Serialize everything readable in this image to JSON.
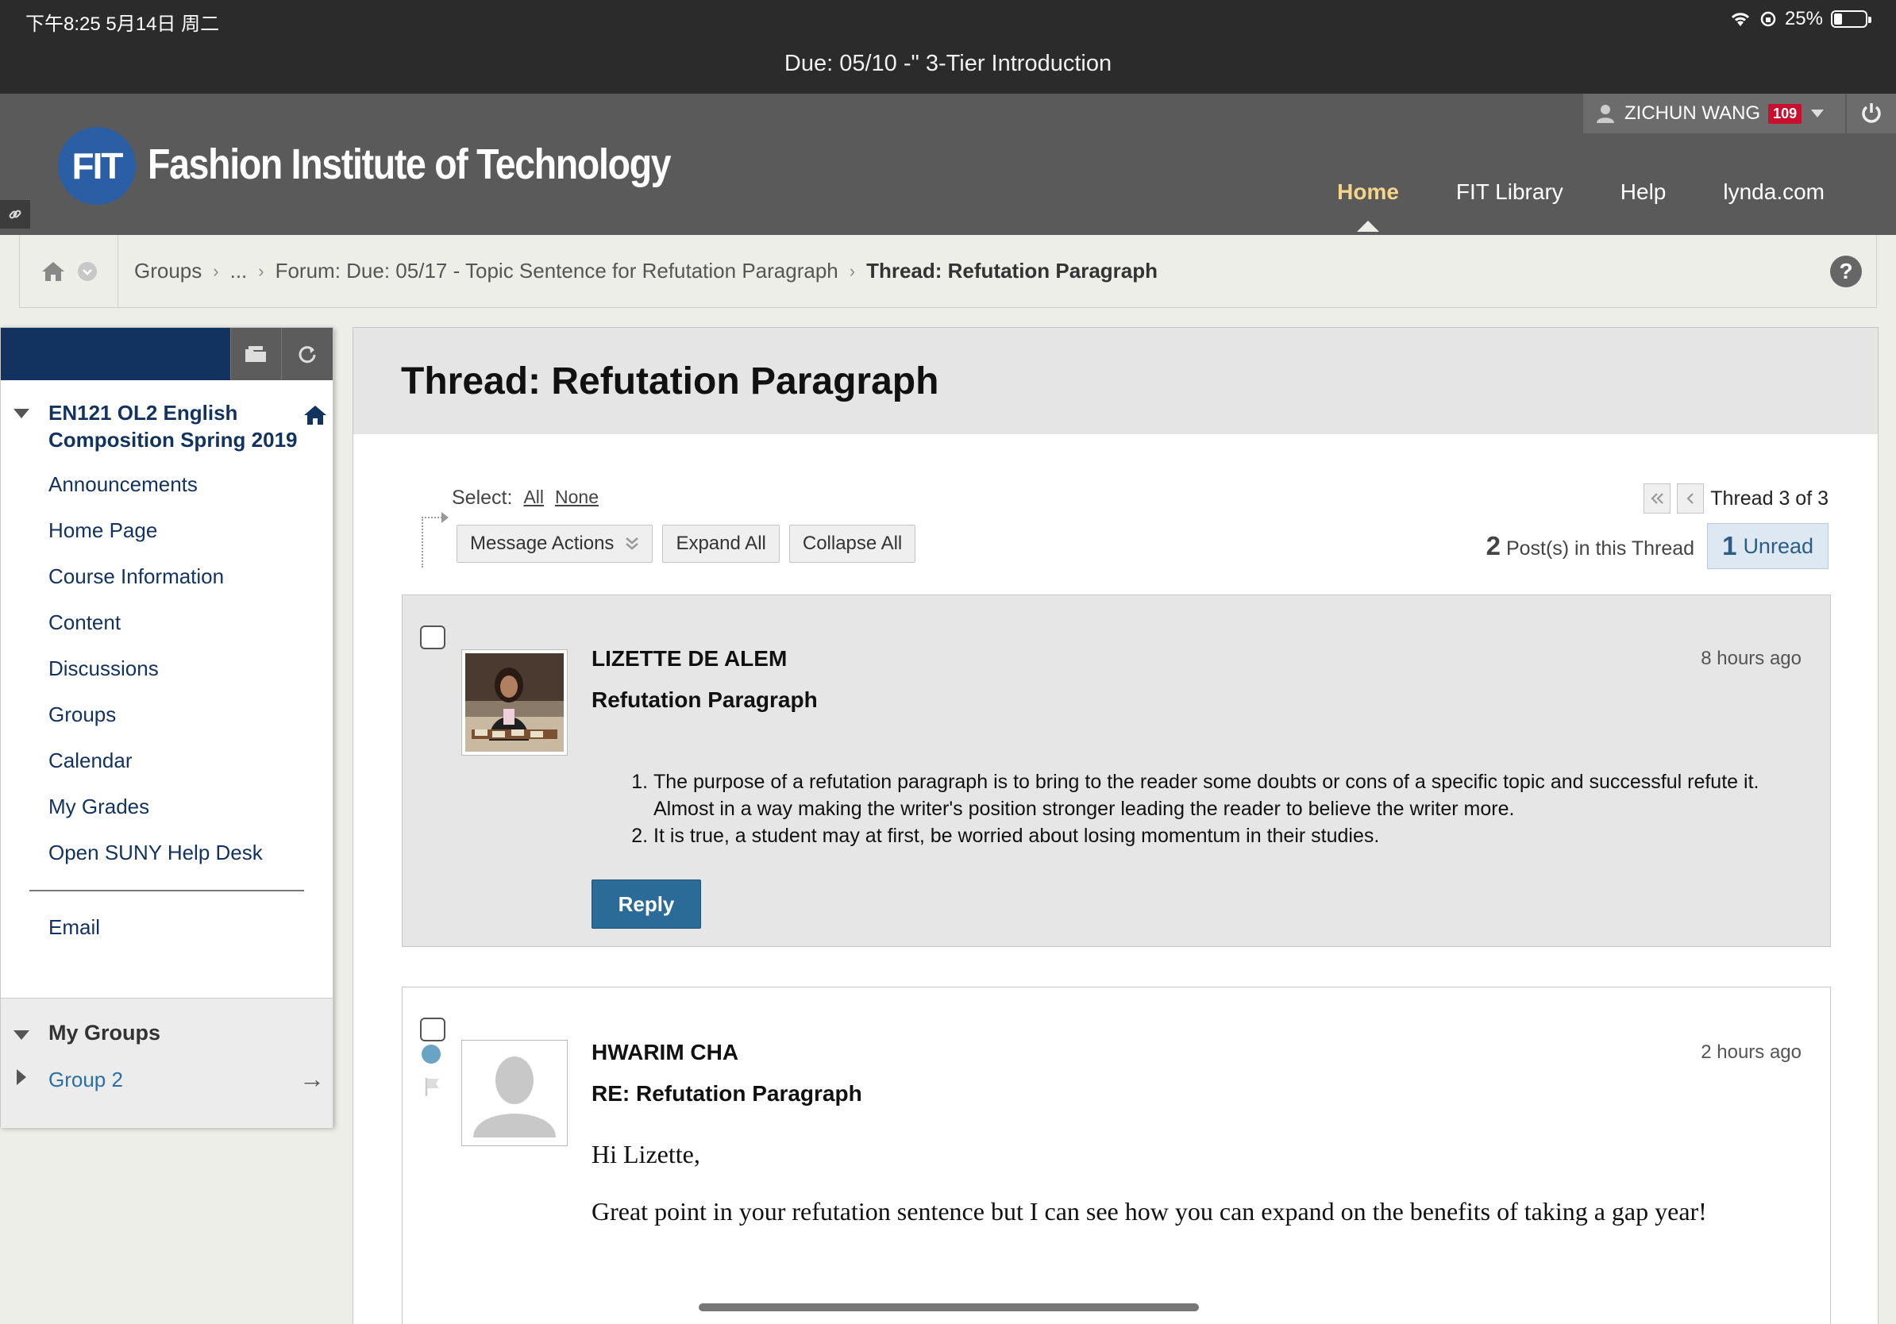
{
  "status": {
    "time": "下午8:25   5月14日 周二",
    "battery_text": "25%",
    "battery_level": 0.25,
    "page_title": "Due: 05/10 -\" 3-Tier Introduction"
  },
  "header": {
    "logo_mark": "FIT",
    "logo_text": "Fashion Institute of Technology",
    "user_name": "ZICHUN WANG",
    "notification_count": "109",
    "nav": [
      "Home",
      "FIT Library",
      "Help",
      "lynda.com"
    ],
    "active_nav": "Home"
  },
  "breadcrumb": {
    "items": [
      "Groups",
      "...",
      "Forum: Due: 05/17 - Topic Sentence for Refutation Paragraph"
    ],
    "current": "Thread: Refutation Paragraph",
    "help": "?"
  },
  "course_menu": {
    "course_title": "EN121 OL2 English Composition Spring 2019",
    "items": [
      "Announcements",
      "Home Page",
      "Course Information",
      "Content",
      "Discussions",
      "Groups",
      "Calendar",
      "My Grades",
      "Open SUNY Help Desk"
    ],
    "email": "Email",
    "my_groups_title": "My Groups",
    "group_item": "Group 2",
    "group_arrow": "→"
  },
  "thread": {
    "title": "Thread: Refutation Paragraph",
    "select_label": "Select:",
    "select_all": "All",
    "select_none": "None",
    "buttons": {
      "message_actions": "Message Actions",
      "expand_all": "Expand All",
      "collapse_all": "Collapse All"
    },
    "thread_position": "Thread 3 of 3",
    "post_count": "2",
    "post_count_label": "Post(s) in this Thread",
    "unread_count": "1",
    "unread_label": "Unread"
  },
  "posts": [
    {
      "author": "LIZETTE DE ALEM",
      "subject": "Refutation Paragraph",
      "time_ago": "8 hours ago",
      "list": [
        "The purpose of a refutation paragraph is to bring to the reader some doubts or cons of a specific topic and successful refute it. Almost in a way making the writer's position stronger leading the reader to believe the writer more.",
        "It is true, a student may at first, be worried about losing momentum in their studies."
      ],
      "reply_label": "Reply"
    },
    {
      "author": "HWARIM CHA",
      "subject": "RE: Refutation Paragraph",
      "time_ago": "2 hours ago",
      "greeting": "Hi Lizette,",
      "body": "Great point in your refutation sentence but I can see how you can expand on the benefits of taking a gap year!"
    }
  ],
  "colors": {
    "header_bg": "#5a5a5a",
    "active_nav": "#f6d58a",
    "course_blue": "#12325f",
    "reply_button": "#2a6b98",
    "badge_red": "#c8102e"
  }
}
